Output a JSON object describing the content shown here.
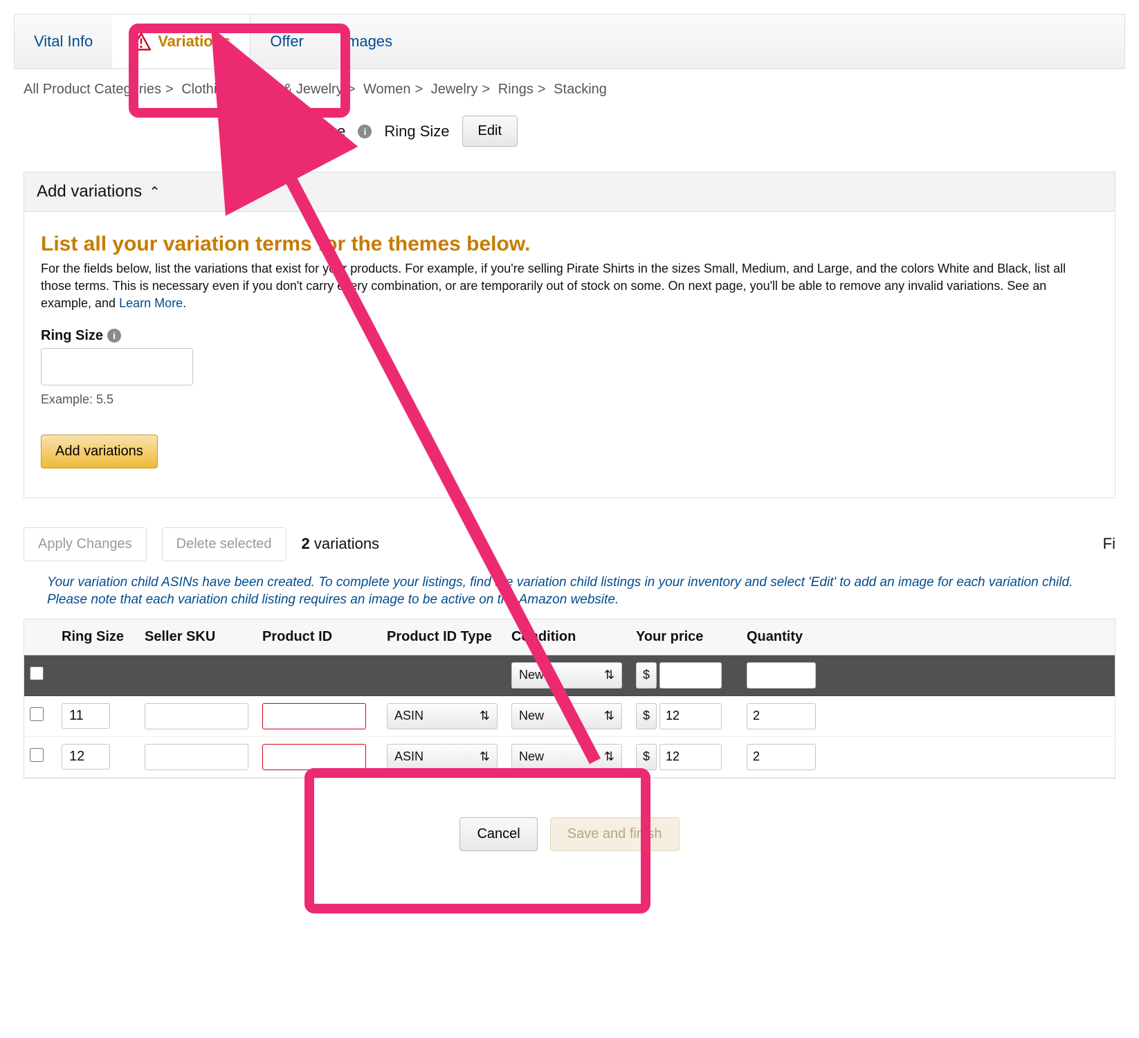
{
  "tabs": {
    "vital": "Vital Info",
    "variations": "Variations",
    "offer": "Offer",
    "images": "Images"
  },
  "breadcrumb": [
    "All Product Categories",
    "Clothing, Shoes & Jewelry",
    "Women",
    "Jewelry",
    "Rings",
    "Stacking"
  ],
  "theme": {
    "label": "Variation Theme",
    "value": "Ring Size",
    "edit": "Edit"
  },
  "panel": {
    "head": "Add variations",
    "title": "List all your variation terms for the themes below.",
    "text1": "For the fields below, list the variations that exist for your products. For example, if you're selling Pirate Shirts in the sizes Small, Medium, and Large, and the colors White and Black, list all those terms. This is necessary even if you don't carry every combination, or are temporarily out of stock on some. On next page, you'll be able to remove any invalid variations. See an example, and ",
    "learn_more": "Learn More",
    "ring_label": "Ring Size",
    "example": "Example:  5.5",
    "add_btn": "Add variations"
  },
  "actions": {
    "apply": "Apply Changes",
    "delete": "Delete selected",
    "count_n": "2",
    "count_label": "variations",
    "fi": "Fi"
  },
  "info_msg": "Your variation child ASINs have been created. To complete your listings, find the variation child listings in your inventory and select 'Edit' to add an image for each variation child. Please note that each variation child listing requires an image to be active on the Amazon website.",
  "table": {
    "headers": {
      "ring_size": "Ring Size",
      "seller_sku": "Seller SKU",
      "product_id": "Product ID",
      "product_id_type": "Product ID Type",
      "condition": "Condition",
      "your_price": "Your price",
      "quantity": "Quantity"
    },
    "all_row": {
      "condition": "New",
      "currency": "$"
    },
    "rows": [
      {
        "ring_size": "11",
        "seller_sku": "",
        "product_id": "",
        "product_id_type": "ASIN",
        "condition": "New",
        "currency": "$",
        "price": "12",
        "quantity": "2"
      },
      {
        "ring_size": "12",
        "seller_sku": "",
        "product_id": "",
        "product_id_type": "ASIN",
        "condition": "New",
        "currency": "$",
        "price": "12",
        "quantity": "2"
      }
    ]
  },
  "footer": {
    "cancel": "Cancel",
    "save": "Save and finish"
  }
}
